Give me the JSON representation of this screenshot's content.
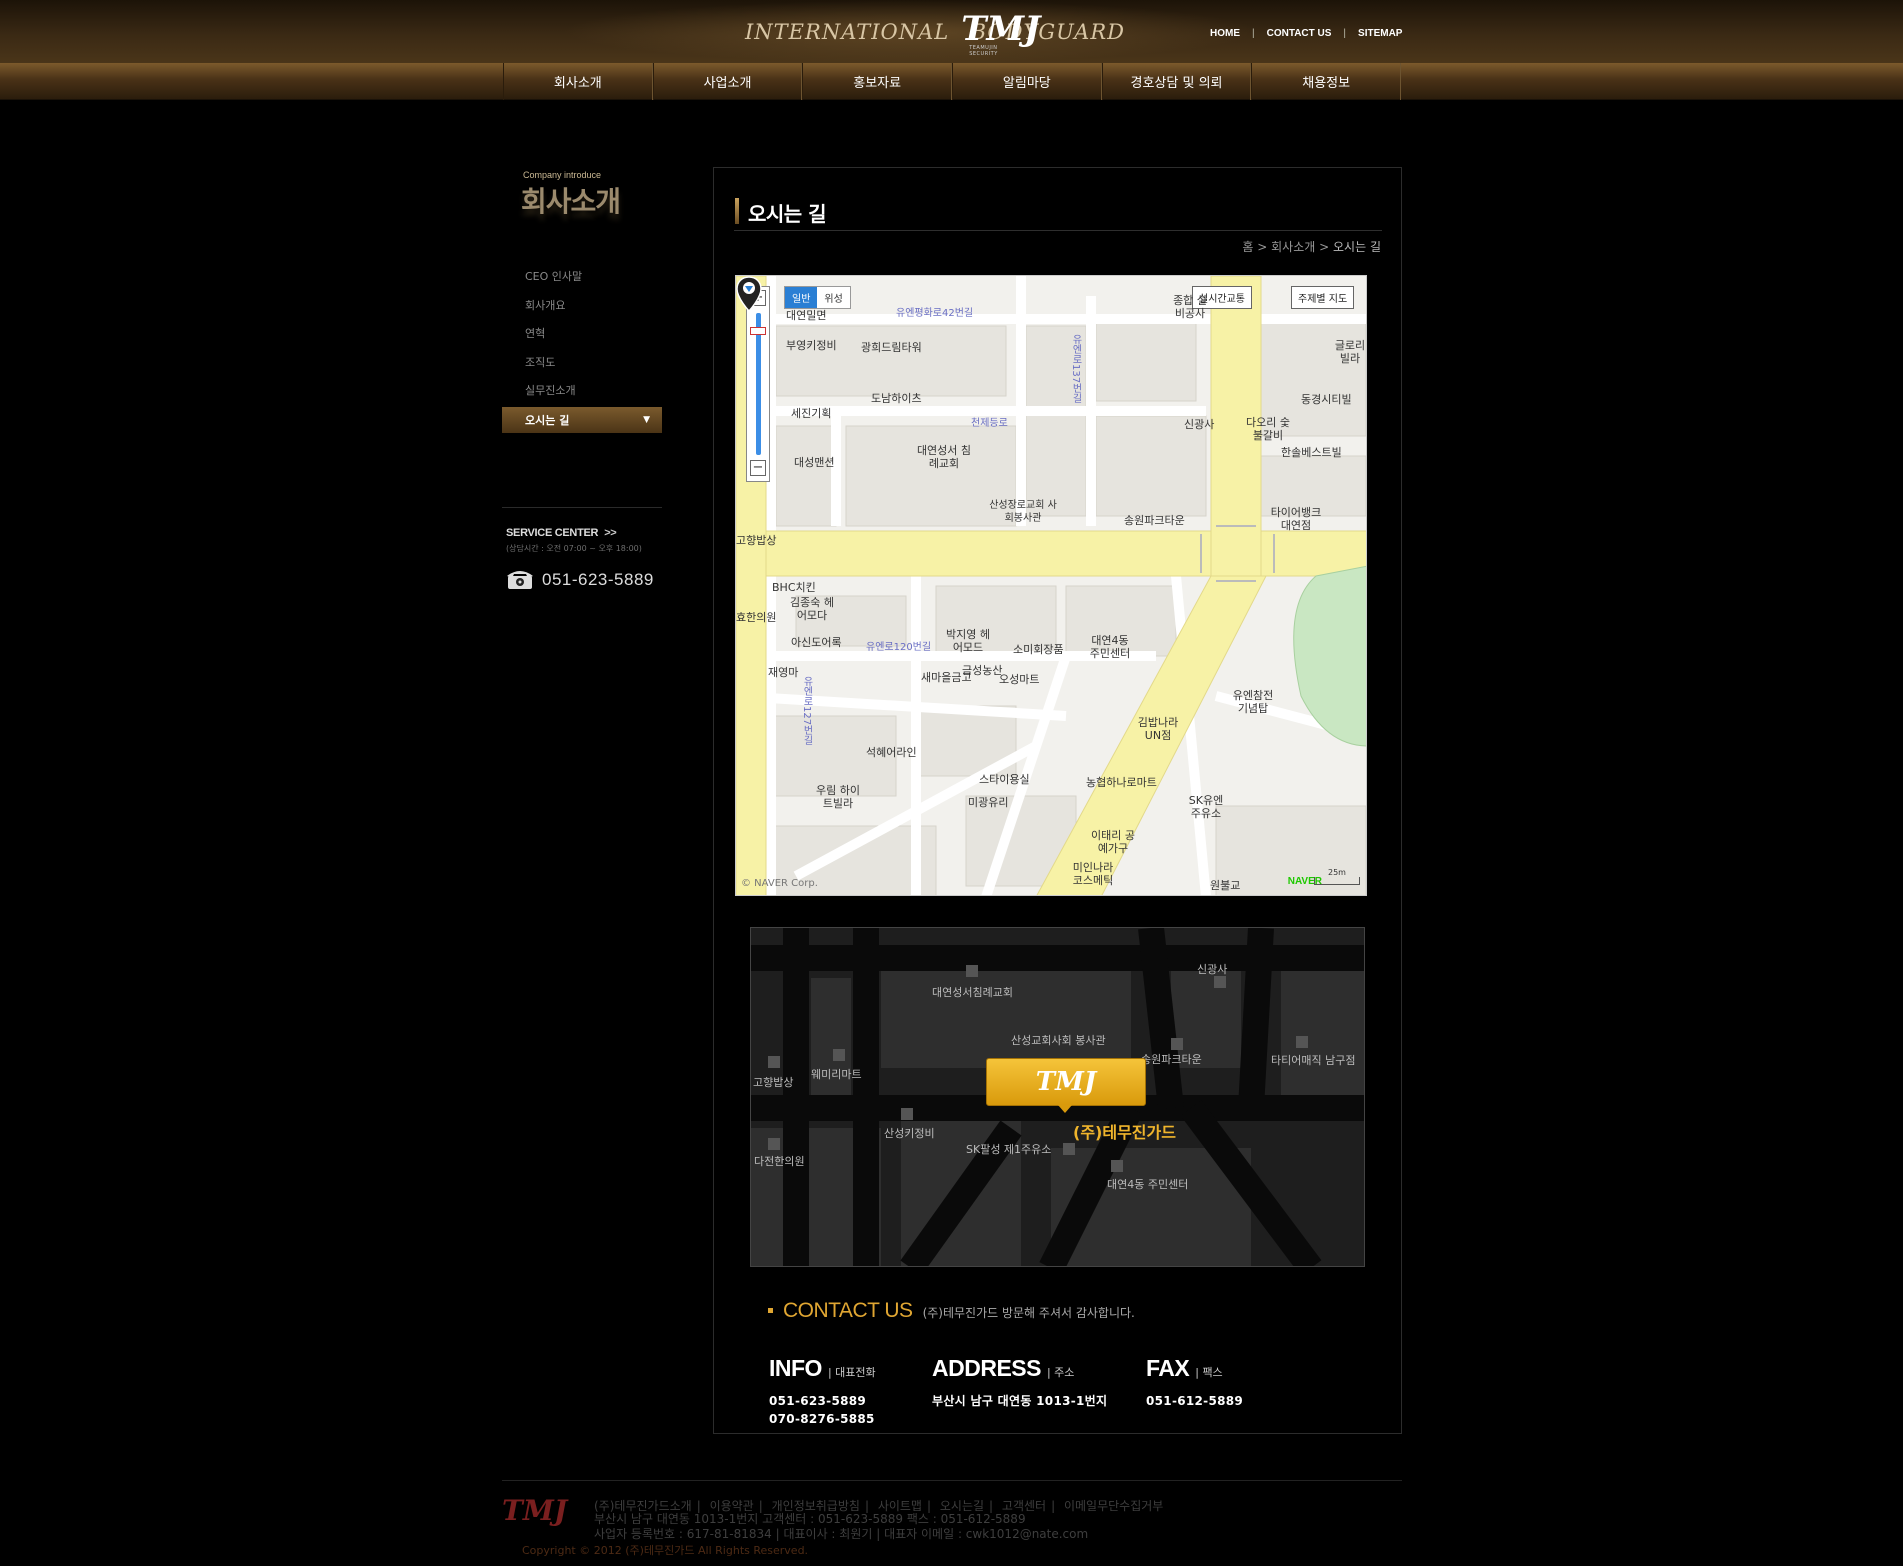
{
  "header": {
    "logo_left": "INTERNATIONAL",
    "logo_mark": "TMJ",
    "logo_sub": "TEAMUJIN SECURITY",
    "logo_right": "BODYGUARD",
    "util_links": [
      "HOME",
      "CONTACT US",
      "SITEMAP"
    ]
  },
  "gnb": [
    "회사소개",
    "사업소개",
    "홍보자료",
    "알림마당",
    "경호상담 및 의뢰",
    "채용정보"
  ],
  "sidebar": {
    "title_en": "Company introduce",
    "title_ko": "회사소개",
    "items": [
      "CEO 인사말",
      "회사개요",
      "연혁",
      "조직도",
      "실무진소개",
      "오시는 길"
    ],
    "active_index": 5,
    "service_center": {
      "title": "SERVICE CENTER",
      "chevron": ">>",
      "hours": "(상담시간 : 오전 07:00 ~ 오후 18:00)",
      "phone": "051-623-5889"
    }
  },
  "page": {
    "title": "오시는 길",
    "breadcrumb": [
      "홈",
      "회사소개",
      "오시는 길"
    ]
  },
  "map": {
    "type_tabs": [
      "일반",
      "위성"
    ],
    "realtime_traffic": "실시간교통",
    "theme_map": "주제별 지도",
    "copyright": "© NAVER Corp.",
    "naver": "NAVER",
    "scale": "25m",
    "labels": [
      "대연밀면",
      "부영키정비",
      "광희드림타워",
      "도남하이츠",
      "세진기획",
      "대연성서 침례교회",
      "대성맨션",
      "산성장로교회 사회봉사관",
      "송원파크타운",
      "고향밥상",
      "BHC치킨",
      "김종숙 헤어모다",
      "효한의원",
      "아신도어록",
      "박지영 헤어모드",
      "소미회장품",
      "대연4동 주민센터",
      "재영마",
      "새마을금고",
      "금성농산",
      "오성마트",
      "김밥나라 UN점",
      "유엔참전 기념탑",
      "석혜어라인",
      "스타이용실",
      "우림 하이트빌라",
      "미광유리",
      "농협하나로마트",
      "SK유엔 주유소",
      "이태리 공예가구",
      "미인나라 코스메틱",
      "원불교",
      "종합 설비공사",
      "신광사",
      "다오리 숯불갈비",
      "한솔베스트빌",
      "동경시티빌",
      "글로리 빌라",
      "타이어뱅크 대연점"
    ],
    "roads": [
      "유엔평화로42번길",
      "유엔로137번길",
      "천제등로",
      "유엔로120번길",
      "유엔로127번길"
    ]
  },
  "illus_map": {
    "labels": [
      "신광사",
      "대연성서침례교회",
      "산성교회사회 봉사관",
      "송원파크타운",
      "타티어매직 남구점",
      "고향밥상",
      "웨미리마트",
      "산성키정비",
      "SK팔성 제1주유소",
      "다전한의원",
      "대연4동 주민센터"
    ],
    "badge": "TMJ",
    "company": "(주)테무진가드"
  },
  "contact": {
    "title": "CONTACT US",
    "desc": "(주)테무진가드 방문해 주셔서 감사합니다.",
    "info": {
      "head": "INFO",
      "head_ko": "대표전화",
      "values": [
        "051-623-5889",
        "070-8276-5885"
      ]
    },
    "address": {
      "head": "ADDRESS",
      "head_ko": "주소",
      "value": "부산시 남구 대연동 1013-1번지"
    },
    "fax": {
      "head": "FAX",
      "head_ko": "팩스",
      "value": "051-612-5889"
    }
  },
  "footer": {
    "logo": "TMJ",
    "links": [
      "(주)테무진가드소개",
      "이용약관",
      "개인정보취급방침",
      "사이트맵",
      "오시는길",
      "고객센터",
      "이메일무단수집거부"
    ],
    "address_line": "부산시 남구 대연동 1013-1번지 고객센터 : 051-623-5889 팩스 : 051-612-5889",
    "biz_line": "사업자 등록번호 : 617-81-81834 | 대표이사 : 최원기 | 대표자 이메일 : cwk1012@nate.com",
    "copyright": "Copyright © 2012 (주)테무진가드 All Rights Reserved."
  },
  "colors": {
    "accent_gold": "#e0a632",
    "header_brown": "#3a2914",
    "map_road_yellow": "#f7f2a6"
  }
}
